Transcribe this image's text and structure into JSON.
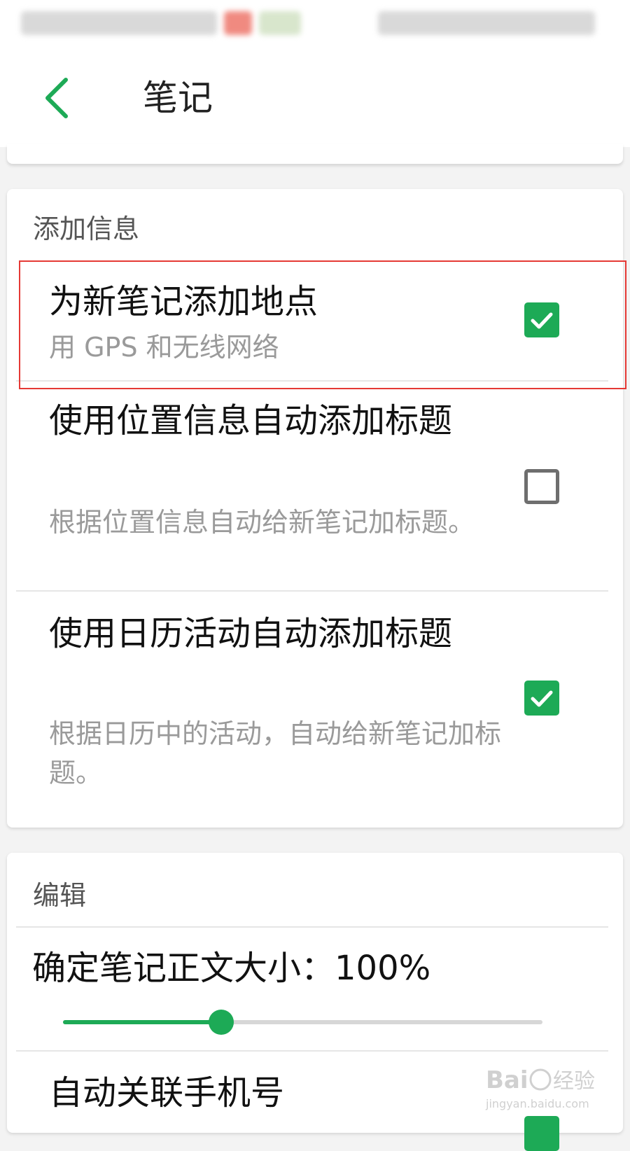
{
  "header": {
    "title": "笔记"
  },
  "sections": {
    "add_info": {
      "title": "添加信息",
      "items": [
        {
          "title": "为新笔记添加地点",
          "subtitle": "用 GPS 和无线网络",
          "checked": true
        },
        {
          "title": "使用位置信息自动添加标题",
          "subtitle": "根据位置信息自动给新笔记加标题。",
          "checked": false
        },
        {
          "title": "使用日历活动自动添加标题",
          "subtitle": "根据日历中的活动，自动给新笔记加标题。",
          "checked": true
        }
      ]
    },
    "edit": {
      "title": "编辑",
      "font_size_label": "确定笔记正文大小：100%",
      "font_size_slider_fraction": 0.33,
      "auto_link_phone_label": "自动关联手机号",
      "auto_link_phone_checked": true
    }
  },
  "watermark": {
    "text": "Baidu经验",
    "url_text": "jingyan.baidu.com"
  },
  "colors": {
    "accent": "#1daa56",
    "highlight": "#e53935"
  }
}
